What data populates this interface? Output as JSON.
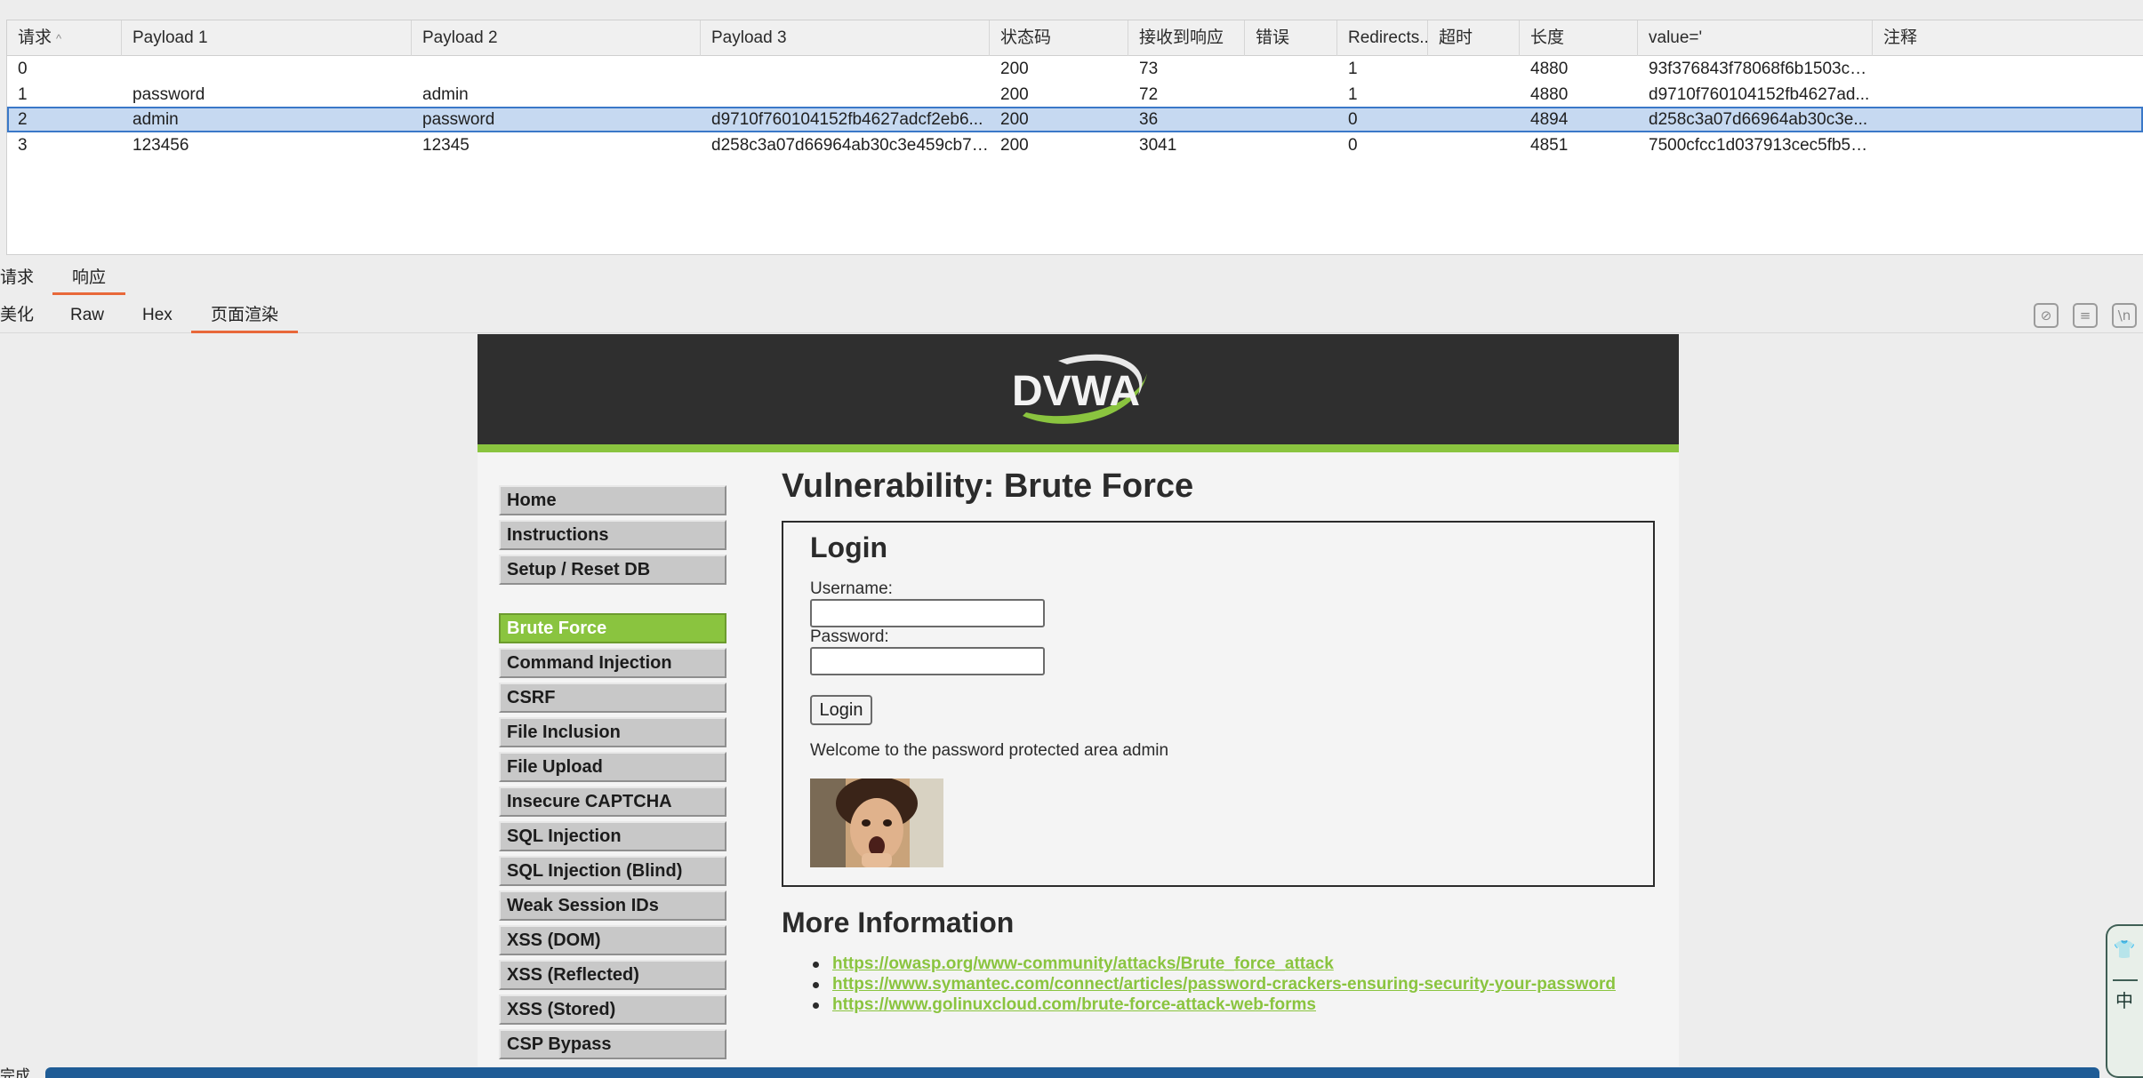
{
  "results": {
    "columns": [
      "请求",
      "Payload 1",
      "Payload 2",
      "Payload 3",
      "状态码",
      "接收到响应",
      "错误",
      "Redirects...",
      "超时",
      "长度",
      "value='",
      "注释"
    ],
    "sort_indicator": "^",
    "rows": [
      [
        "0",
        "",
        "",
        "",
        "200",
        "73",
        "",
        "1",
        "",
        "4880",
        "93f376843f78068f6b1503cd...",
        ""
      ],
      [
        "1",
        "password",
        "admin",
        "",
        "200",
        "72",
        "",
        "1",
        "",
        "4880",
        "d9710f760104152fb4627ad...",
        ""
      ],
      [
        "2",
        "admin",
        "password",
        "d9710f760104152fb4627adcf2eb6...",
        "200",
        "36",
        "",
        "0",
        "",
        "4894",
        "d258c3a07d66964ab30c3e...",
        ""
      ],
      [
        "3",
        "123456",
        "12345",
        "d258c3a07d66964ab30c3e459cb7c...",
        "200",
        "3041",
        "",
        "0",
        "",
        "4851",
        "7500cfcc1d037913cec5fb5c...",
        ""
      ]
    ]
  },
  "request_response_tabs": [
    "请求",
    "响应"
  ],
  "view_tabs": [
    "美化",
    "Raw",
    "Hex",
    "页面渲染"
  ],
  "toolbar_icons": [
    "eye-off-icon",
    "wrap-lines-icon",
    "newline-icon"
  ],
  "dvwa": {
    "logo_text": "DVWA",
    "menu_group_1": [
      "Home",
      "Instructions",
      "Setup / Reset DB"
    ],
    "menu_group_2": [
      "Brute Force",
      "Command Injection",
      "CSRF",
      "File Inclusion",
      "File Upload",
      "Insecure CAPTCHA",
      "SQL Injection",
      "SQL Injection (Blind)",
      "Weak Session IDs",
      "XSS (DOM)",
      "XSS (Reflected)",
      "XSS (Stored)",
      "CSP Bypass"
    ],
    "page_title": "Vulnerability: Brute Force",
    "login_title": "Login",
    "username_label": "Username:",
    "password_label": "Password:",
    "username_value": "",
    "password_value": "",
    "login_button": "Login",
    "welcome": "Welcome to the password protected area admin",
    "more_info_title": "More Information",
    "links": [
      "https://owasp.org/www-community/attacks/Brute_force_attack",
      "https://www.symantec.com/connect/articles/password-crackers-ensuring-security-your-password",
      "https://www.golinuxcloud.com/brute-force-attack-web-forms"
    ]
  },
  "status": {
    "label": "完成"
  },
  "side_widget": {
    "icon": "shirt-icon",
    "label": "中"
  },
  "colors": {
    "accent_orange": "#e8683a",
    "dvwa_green": "#8ac43f",
    "selected_row": "#c6d9f1",
    "status_bar": "#1f5c96"
  }
}
